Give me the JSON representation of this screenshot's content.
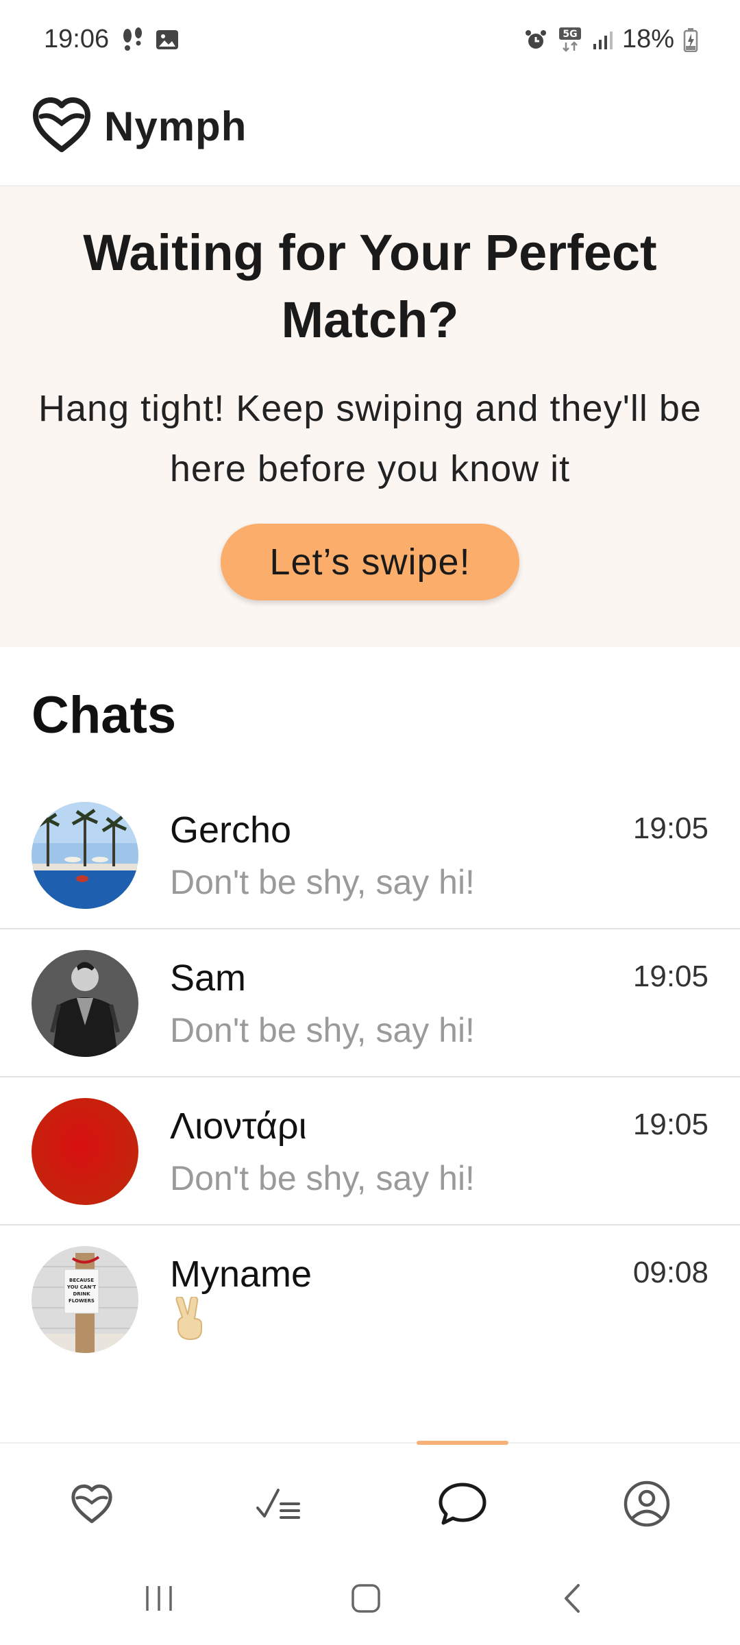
{
  "status_bar": {
    "time": "19:06",
    "battery": "18%",
    "network": "5G"
  },
  "app": {
    "title": "Nymph"
  },
  "banner": {
    "title": "Waiting for Your Perfect Match?",
    "subtitle": "Hang tight! Keep swiping and they'll be here before you know it",
    "button_label": "Let’s swipe!"
  },
  "chats": {
    "heading": "Chats",
    "items": [
      {
        "name": "Gercho",
        "time": "19:05",
        "preview": "Don't be shy, say hi!",
        "avatar": "pool-palm-trees-photo"
      },
      {
        "name": "Sam",
        "time": "19:05",
        "preview": "Don't be shy, say hi!",
        "avatar": "man-leather-jacket-photo"
      },
      {
        "name": "Λιοντάρι",
        "time": "19:05",
        "preview": "Don't be shy, say hi!",
        "avatar": "red-circle-photo"
      },
      {
        "name": "Myname",
        "time": "09:08",
        "preview": "✌️",
        "avatar": "bottle-gift-tag-photo",
        "avatar_tag_text": "BECAUSE YOU CAN'T DRINK FLOWERS"
      }
    ]
  },
  "bottom_nav": {
    "items": [
      "heart-icon",
      "checklist-icon",
      "chat-bubble-icon",
      "profile-icon"
    ],
    "active": "chat-bubble-icon",
    "accent": "#f7b27a"
  },
  "colors": {
    "button": "#fbae6b",
    "banner_bg": "#fcf6f2",
    "muted_text": "#9a9a9a"
  }
}
